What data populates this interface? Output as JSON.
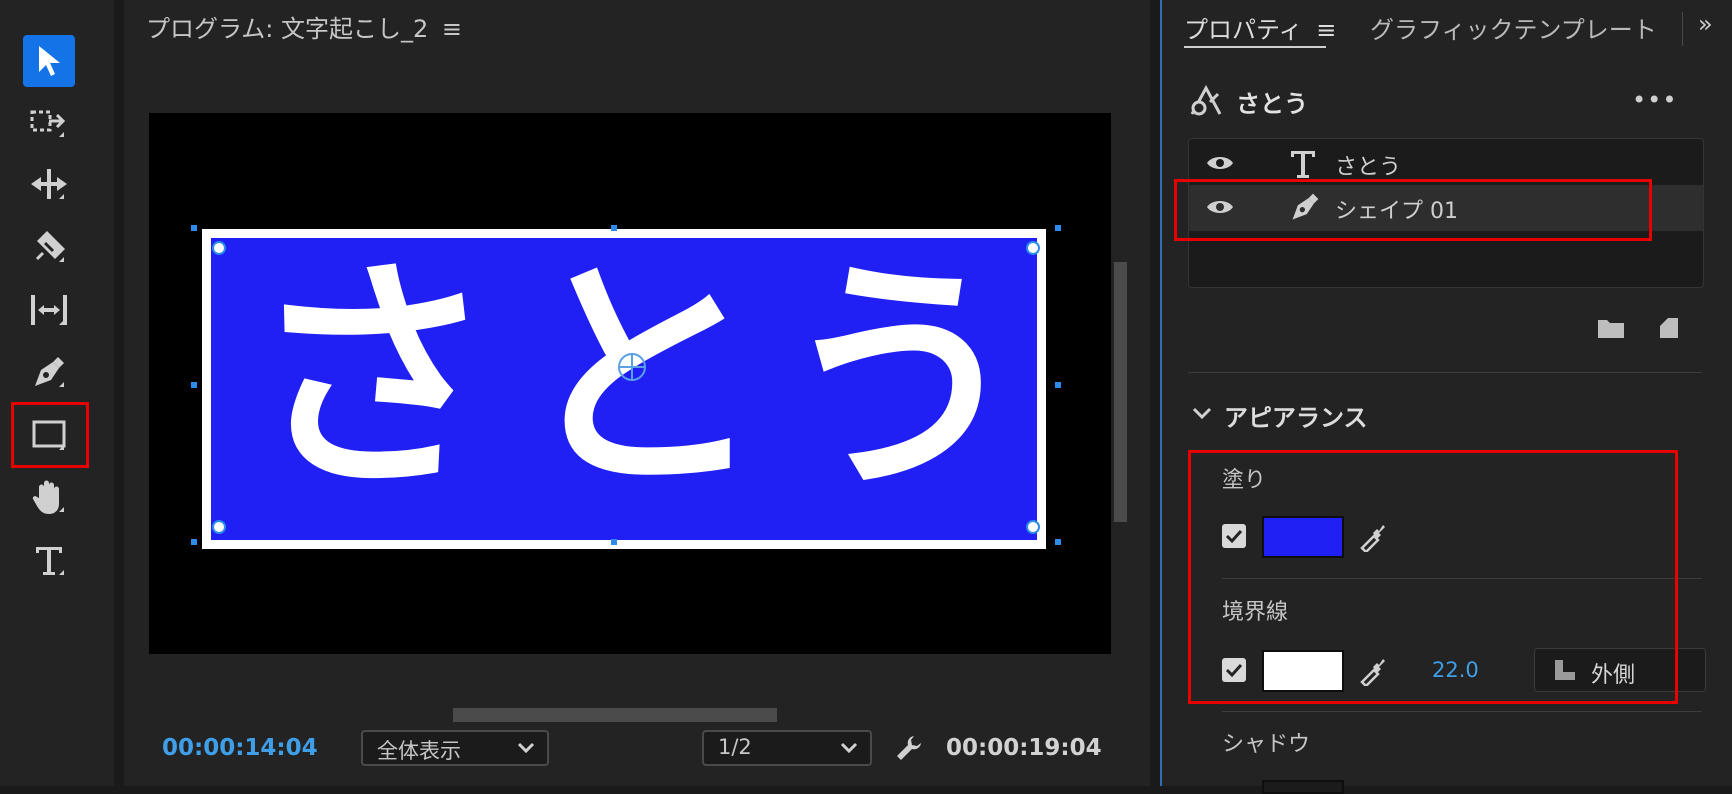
{
  "toolbar": {
    "tools": [
      "selection-tool",
      "track-select-tool",
      "ripple-edit-tool",
      "razor-tool",
      "slip-tool",
      "pen-tool",
      "rectangle-tool",
      "hand-tool",
      "type-tool"
    ],
    "selected": "selection-tool"
  },
  "monitor": {
    "title": "プログラム: 文字起こし_2",
    "canvas_text": {
      "char1": "さ",
      "char2": "と",
      "char3": "う"
    },
    "shape_fill_color": "#2020f4",
    "shape_stroke_color": "#ffffff",
    "timecode_current": "00:00:14:04",
    "zoom": "全体表示",
    "resolution": "1/2",
    "timecode_duration": "00:00:19:04"
  },
  "properties": {
    "tab_active": "プロパティ",
    "tab_other": "グラフィックテンプレート",
    "object_name": "さとう",
    "layers": [
      {
        "name": "さとう",
        "type": "text"
      },
      {
        "name": "シェイプ 01",
        "type": "shape",
        "selected": true
      }
    ],
    "appearance": {
      "title": "アピアランス",
      "fill_label": "塗り",
      "fill_color": "#2020f4",
      "fill_enabled": true,
      "stroke_label": "境界線",
      "stroke_color": "#ffffff",
      "stroke_enabled": true,
      "stroke_width": "22.0",
      "stroke_position": "外側",
      "shadow_label": "シャドウ"
    }
  },
  "accent": "#1473e6",
  "highlight": "#e60000"
}
